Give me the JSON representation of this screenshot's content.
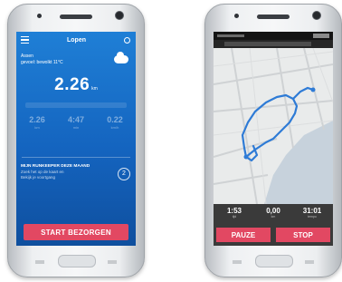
{
  "left_phone": {
    "topbar": {
      "title": "Lopen",
      "menu_icon": "hamburger-menu-icon",
      "gps_icon": "gps-icon"
    },
    "weather": {
      "location": "Assen",
      "condition": "gevoel: bewolkt 11°C",
      "icon": "cloud-icon"
    },
    "distance": {
      "value": "2.26",
      "unit": "km"
    },
    "stats": [
      {
        "value": "2.26",
        "label": "km"
      },
      {
        "value": "4:47",
        "label": "min"
      },
      {
        "value": "0.22",
        "label": "km/h"
      }
    ],
    "promo": {
      "heading": "MIJN RUNKEEPER DEZE MAAND",
      "lines": [
        "Zoek het op de kaart en",
        "Bekijk je voortgang"
      ]
    },
    "badge_value": "2",
    "start_button": "START BEZORGEN",
    "colors": {
      "accent": "#e24862",
      "screen": "#1464bf"
    }
  },
  "right_phone": {
    "stats": [
      {
        "value": "1:53",
        "label": "tijd"
      },
      {
        "value": "0,00",
        "label": "km"
      },
      {
        "value": "31:01",
        "label": "tempo"
      }
    ],
    "pause_button": "PAUZE",
    "stop_button": "STOP",
    "colors": {
      "route": "#2e7bd6",
      "water": "#c7d2dc",
      "map": "#e9ebeb"
    }
  }
}
